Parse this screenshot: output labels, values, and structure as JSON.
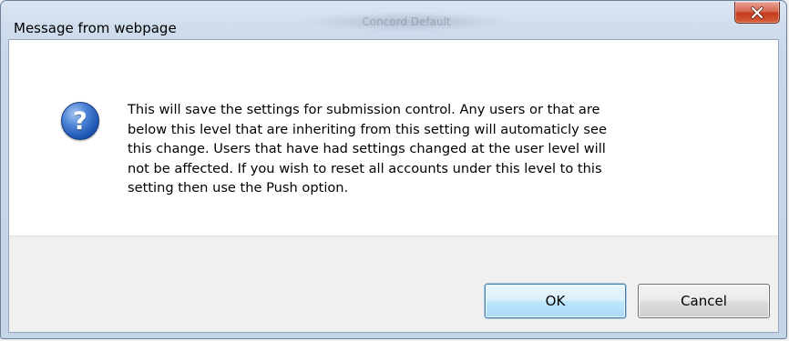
{
  "window": {
    "title": "Message from webpage",
    "background_title": "Concord Default"
  },
  "message": {
    "icon": "question-icon",
    "icon_glyph": "?",
    "text": "This will save the settings for submission control. Any users or that are\nbelow this level that are inheriting from this setting will automaticly see\nthis change. Users that have had settings changed at the user level will\nnot be affected. If you wish to reset all accounts under this level to this\nsetting then use the Push option."
  },
  "buttons": {
    "ok_label": "OK",
    "cancel_label": "Cancel"
  },
  "colors": {
    "close_button": "#c43a1c",
    "icon_blue": "#1f55b4",
    "default_button_border": "#3c7fb1"
  }
}
